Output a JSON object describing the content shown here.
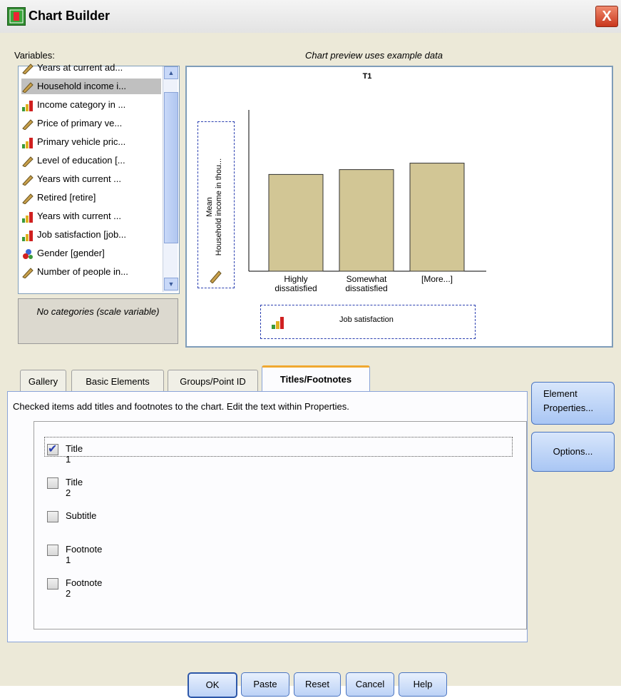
{
  "window": {
    "title": "Chart Builder",
    "close": "X"
  },
  "variables": {
    "label": "Variables:",
    "items": [
      {
        "label": "Years at current ad...",
        "icon": "scale-ruler-icon"
      },
      {
        "label": "Household income i...",
        "icon": "scale-ruler-icon",
        "selected": true
      },
      {
        "label": "Income category in ...",
        "icon": "ordinal-bars-icon"
      },
      {
        "label": "Price of primary ve...",
        "icon": "scale-ruler-icon"
      },
      {
        "label": "Primary vehicle pric...",
        "icon": "ordinal-bars-icon"
      },
      {
        "label": "Level of education [...",
        "icon": "scale-ruler-icon"
      },
      {
        "label": "Years with current ...",
        "icon": "scale-ruler-icon"
      },
      {
        "label": "Retired [retire]",
        "icon": "scale-ruler-icon"
      },
      {
        "label": "Years with current ...",
        "icon": "ordinal-bars-icon"
      },
      {
        "label": "Job satisfaction [job...",
        "icon": "ordinal-bars-icon"
      },
      {
        "label": "Gender [gender]",
        "icon": "nominal-circles-icon"
      },
      {
        "label": "Number of people in...",
        "icon": "scale-ruler-icon"
      }
    ],
    "categories_note": "No categories (scale variable)"
  },
  "preview": {
    "note": "Chart preview uses example data",
    "title": "T1",
    "y_axis_label_line1": "Mean",
    "y_axis_label_line2": "Household income in thou...",
    "x_axis_label": "Job satisfaction"
  },
  "chart_data": {
    "type": "bar",
    "title": "T1",
    "categories": [
      "Highly dissatisfied",
      "Somewhat dissatisfied",
      "[More...]"
    ],
    "category_lines": [
      [
        "Highly",
        "dissatisfied"
      ],
      [
        "Somewhat",
        "dissatisfied"
      ],
      [
        "[More...]",
        ""
      ]
    ],
    "values": [
      0.6,
      0.63,
      0.67
    ],
    "ylim": [
      0,
      1
    ],
    "xlabel": "Job satisfaction",
    "ylabel": "Mean Household income in thou...",
    "bar_color": "#d2c695"
  },
  "tabs": [
    {
      "label": "Gallery"
    },
    {
      "label": "Basic Elements"
    },
    {
      "label": "Groups/Point ID"
    },
    {
      "label": "Titles/Footnotes",
      "active": true
    }
  ],
  "titles_panel": {
    "description": "Checked items add titles and footnotes to the chart. Edit the text within Properties.",
    "options": [
      {
        "label": "Title 1",
        "checked": true
      },
      {
        "label": "Title 2",
        "checked": false
      },
      {
        "label": "Subtitle",
        "checked": false
      },
      {
        "label": "Footnote 1",
        "checked": false
      },
      {
        "label": "Footnote 2",
        "checked": false
      }
    ]
  },
  "side_buttons": {
    "element_properties_line1": "Element",
    "element_properties_line2": "Properties...",
    "options": "Options..."
  },
  "buttons": {
    "ok": "OK",
    "paste": "Paste",
    "reset": "Reset",
    "cancel": "Cancel",
    "help": "Help"
  }
}
